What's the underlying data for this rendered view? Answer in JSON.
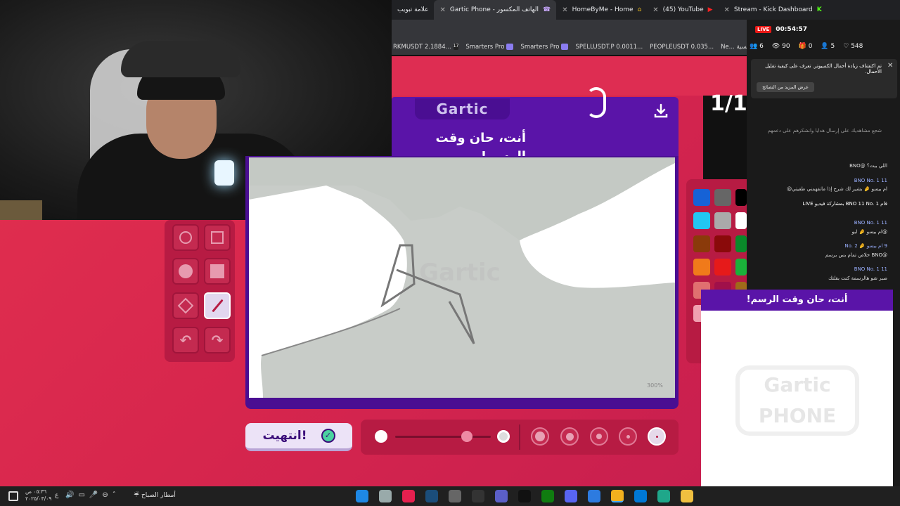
{
  "browser": {
    "tabs": [
      {
        "label": "علامة تبويب"
      },
      {
        "label": "Gartic Phone - الهاتف المكسور"
      },
      {
        "label": "HomeByMe - Home"
      },
      {
        "label": "(45) YouTube"
      },
      {
        "label": "Stream - Kick Dashboard"
      }
    ],
    "bookmarks": [
      "RKMUSDT 2.1884...",
      "Smarters Pro",
      "Smarters Pro",
      "SPELLUSDT.P 0.0011...",
      "PEOPLEUSDT 0.035...",
      "Ne... الصفحة الرئيسية"
    ]
  },
  "game": {
    "logo": "Gartic",
    "prompt": "أنت، حان وقت الرسم!",
    "round": "1/1",
    "zoom": "300%",
    "done_label": "انتهيت!",
    "colors": {
      "accent": "#5a14a8",
      "bg": "#e2304f"
    },
    "palette": [
      "#1662d6",
      "#666666",
      "#000000",
      "#22c7f2",
      "#aaaaaa",
      "#ffffff",
      "#8a3a0a",
      "#8a0a0a",
      "#0a8a2a",
      "#f07a1a",
      "#e61a1a",
      "#1ab23a",
      "#e07070",
      "#a0104a",
      "#a06a1a",
      "#f0a0b0"
    ],
    "brush_sizes": [
      "size-1",
      "size-2",
      "size-3",
      "size-4",
      "size-5"
    ],
    "opacity_level": 0.75
  },
  "stream": {
    "live": "LIVE",
    "timer": "00:54:57",
    "stats": [
      "6",
      "90",
      "0",
      "5",
      "548"
    ],
    "notice_text": "تم اكتشاف زيادة أحمال الكمبيوتر. تعرف على كيفية تقليل الأحمال.",
    "notice_button": "عرض المزيد من النصائح",
    "chat_hint": "شجع مشاهديك على إرسال هدايا وانشكرهم على دعمهم",
    "chat": [
      {
        "meta": "",
        "text": "اللي بيت؟ @BNO"
      },
      {
        "meta": "11 BNO No. 1",
        "text": "ام بيسو 🤌 بشير لك شرح إذا ماتفهمني طفيتي@"
      },
      {
        "meta": "",
        "text": "قام BNO 11 No. 1 بمشاركة فيديو LIVE"
      },
      {
        "meta": "11 BNO No. 1",
        "text": "@ام بيسو 🤌 لبو"
      },
      {
        "meta": "9 ام بيسو 🤌 No. 2",
        "text": "@BNO خلاص تمام بس برسم"
      },
      {
        "meta": "11 BNO No. 1",
        "text": "صبر شو هالرسمة كنت بقلتك"
      }
    ],
    "overlay_prompt": "أنت، حان وقت الرسم!",
    "overlay_logo": "Gartic PHONE"
  },
  "taskbar": {
    "time": "٠٥:٣٦ ص",
    "date": "٢٠٢٥/٠٣/٠٩",
    "lang": "ع",
    "weather": "أمطار الصباح"
  }
}
